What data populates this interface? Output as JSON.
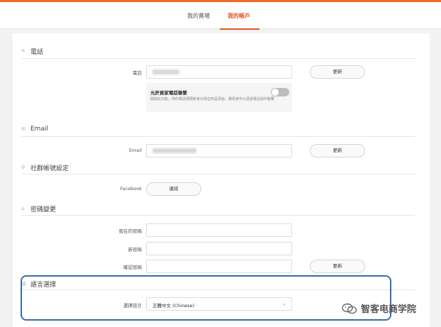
{
  "tabs": [
    {
      "label": "我的賣場",
      "active": false
    },
    {
      "label": "我的帳戶",
      "active": true
    }
  ],
  "colors": {
    "accent": "#e2582a",
    "highlight_border": "#3a6ea5"
  },
  "sections": {
    "phone": {
      "title": "電話",
      "icon": "pencil-icon",
      "field_label": "電話",
      "update_label": "更新",
      "toggle_title": "允許買家電話聯繫",
      "toggle_desc": "開啟此功能，你的電話號碼將會出現在商品頁面，購買家可以透過電話與你聯繫",
      "toggle_on": false
    },
    "email": {
      "title": "Email",
      "icon": "mail-icon",
      "field_label": "Email",
      "update_label": "更新"
    },
    "social": {
      "title": "社群帳號設定",
      "icon": "link-icon",
      "facebook_label": "Facebook",
      "connect_label": "連結"
    },
    "password": {
      "title": "密碼變更",
      "icon": "lock-icon",
      "current_label": "我在的密碼",
      "new_label": "新密碼",
      "confirm_label": "確認密碼",
      "update_label": "更新"
    },
    "language": {
      "title": "語言選擇",
      "icon": "doc-icon",
      "select_label": "選擇語言",
      "selected": "正體中文 (Chinese)"
    }
  },
  "watermark": {
    "text": "智客电商学院"
  }
}
